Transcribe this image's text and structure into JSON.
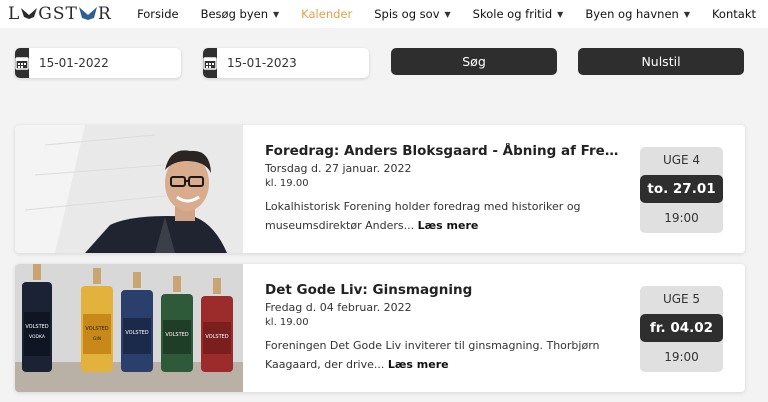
{
  "header": {
    "logo_text": "LØGSTØR",
    "nav": [
      {
        "label": "Forside",
        "dropdown": false,
        "active": false
      },
      {
        "label": "Besøg byen",
        "dropdown": true,
        "active": false
      },
      {
        "label": "Kalender",
        "dropdown": false,
        "active": true
      },
      {
        "label": "Spis og sov",
        "dropdown": true,
        "active": false
      },
      {
        "label": "Skole og fritid",
        "dropdown": true,
        "active": false
      },
      {
        "label": "Byen og havnen",
        "dropdown": true,
        "active": false
      },
      {
        "label": "Kontakt",
        "dropdown": false,
        "active": false
      }
    ],
    "active_color": "#e0a24a"
  },
  "filter": {
    "start_date": "15-01-2022",
    "end_date": "15-01-2023",
    "search_label": "Søg",
    "reset_label": "Nulstil"
  },
  "events": [
    {
      "title": "Foredrag: Anders Bloksgaard - Åbning af Frede...",
      "date": "Torsdag d. 27 januar. 2022",
      "time": "kl. 19.00",
      "description": "Lokalhistorisk Forening holder foredrag med historiker og museumsdirektør Anders...",
      "more_label": "Læs mere",
      "week": "UGE 4",
      "day": "to. 27.01",
      "hour": "19:00"
    },
    {
      "title": "Det Gode Liv: Ginsmagning",
      "date": "Fredag d. 04 februar. 2022",
      "time": "kl. 19.00",
      "description": "Foreningen Det Gode Liv inviterer til ginsmagning. Thorbjørn Kaagaard, der drive...",
      "more_label": "Læs mere",
      "week": "UGE 5",
      "day": "fr. 04.02",
      "hour": "19:00",
      "bottle_labels": [
        "VOLSTED",
        "VODKA",
        "GIN"
      ]
    }
  ],
  "colors": {
    "dark": "#2e2e2e",
    "badge_bg": "#e0e0e0",
    "page_bg": "#f3f3f3"
  }
}
